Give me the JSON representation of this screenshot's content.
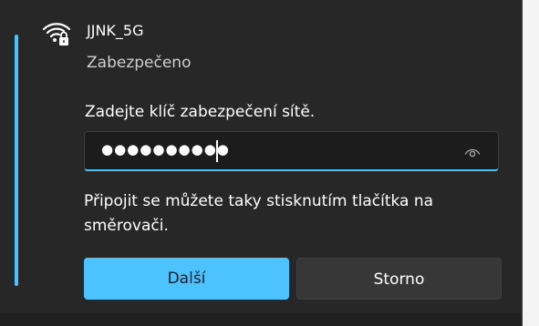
{
  "network": {
    "ssid": "JJNK_5G",
    "status": "Zabezpečeno",
    "icon": "wifi-secured-icon"
  },
  "password": {
    "prompt": "Zadejte klíč zabezpečení sítě.",
    "masked_value": "●●●●●●●●●●",
    "reveal_icon": "eye-icon"
  },
  "hint": "Připojit se můžete taky stisknutím tlačítka na směrovači.",
  "buttons": {
    "next": "Další",
    "cancel": "Storno"
  },
  "colors": {
    "accent": "#4cc2ff",
    "panel_bg": "#272727",
    "input_bg": "#1c1c1c",
    "secondary_button": "#373737"
  }
}
